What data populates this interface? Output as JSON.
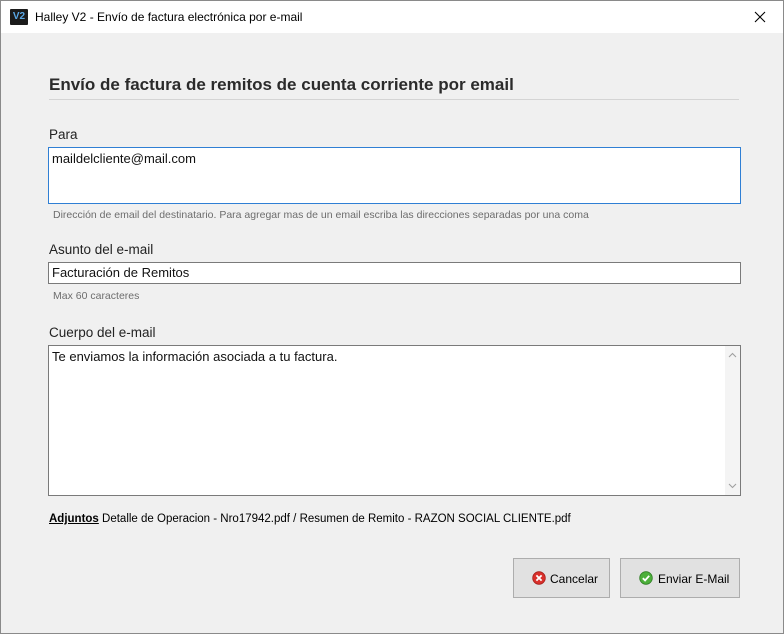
{
  "window": {
    "title": "Halley V2 - Envío de factura electrónica por e-mail",
    "app_icon_text": "V2"
  },
  "form": {
    "heading": "Envío de factura de remitos de cuenta corriente por email",
    "to": {
      "label": "Para",
      "value": "maildelcliente@mail.com",
      "hint": "Dirección de email del destinatario. Para agregar mas de un email escriba las direcciones separadas por una coma"
    },
    "subject": {
      "label": "Asunto del e-mail",
      "value": "Facturación de Remitos",
      "hint": "Max 60 caracteres"
    },
    "body": {
      "label": "Cuerpo del e-mail",
      "value": "Te enviamos la información asociada a tu factura."
    },
    "attachments": {
      "label": "Adjuntos",
      "value": "Detalle de Operacion - Nro17942.pdf / Resumen de Remito - RAZON SOCIAL CLIENTE.pdf"
    }
  },
  "buttons": {
    "cancel_label": "Cancelar",
    "send_label": "Enviar E-Mail"
  },
  "icons": {
    "close": "close-icon",
    "cancel": "cancel-icon",
    "send": "check-icon"
  },
  "colors": {
    "focus_border": "#2f7fd4",
    "cancel_icon": "#d9302b",
    "send_icon": "#4caf3a"
  }
}
